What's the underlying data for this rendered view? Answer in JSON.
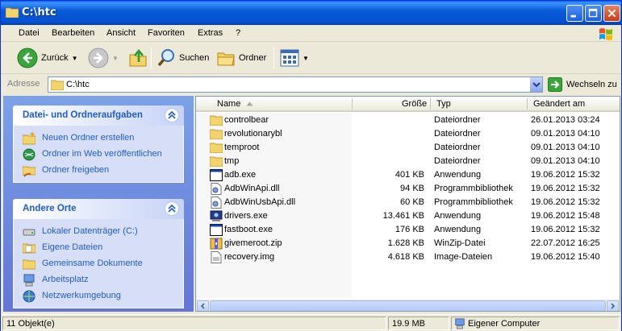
{
  "window": {
    "title": "C:\\htc"
  },
  "menu": [
    "Datei",
    "Bearbeiten",
    "Ansicht",
    "Favoriten",
    "Extras",
    "?"
  ],
  "toolbar": {
    "back_label": "Zurück",
    "search_label": "Suchen",
    "folders_label": "Ordner"
  },
  "address": {
    "label": "Adresse",
    "value": "C:\\htc",
    "go_label": "Wechseln zu"
  },
  "taskpane": {
    "file_tasks": {
      "title": "Datei- und Ordneraufgaben",
      "items": [
        {
          "label": "Neuen Ordner erstellen",
          "icon": "new-folder-icon"
        },
        {
          "label": "Ordner im Web veröffentlichen",
          "icon": "web-publish-icon"
        },
        {
          "label": "Ordner freigeben",
          "icon": "share-folder-icon"
        }
      ]
    },
    "other_places": {
      "title": "Andere Orte",
      "items": [
        {
          "label": "Lokaler Datenträger (C:)",
          "icon": "drive-icon"
        },
        {
          "label": "Eigene Dateien",
          "icon": "my-documents-icon"
        },
        {
          "label": "Gemeinsame Dokumente",
          "icon": "shared-documents-icon"
        },
        {
          "label": "Arbeitsplatz",
          "icon": "my-computer-icon"
        },
        {
          "label": "Netzwerkumgebung",
          "icon": "network-icon"
        }
      ]
    }
  },
  "list": {
    "columns": {
      "name": "Name",
      "size": "Größe",
      "type": "Typ",
      "modified": "Geändert am"
    },
    "rows": [
      {
        "name": "controlbear",
        "size": "",
        "type": "Dateiordner",
        "modified": "26.01.2013 03:24",
        "icon": "folder-icon"
      },
      {
        "name": "revolutionarybl",
        "size": "",
        "type": "Dateiordner",
        "modified": "09.01.2013 04:10",
        "icon": "folder-icon"
      },
      {
        "name": "temproot",
        "size": "",
        "type": "Dateiordner",
        "modified": "09.01.2013 04:10",
        "icon": "folder-icon"
      },
      {
        "name": "tmp",
        "size": "",
        "type": "Dateiordner",
        "modified": "09.01.2013 04:10",
        "icon": "folder-icon"
      },
      {
        "name": "adb.exe",
        "size": "401 KB",
        "type": "Anwendung",
        "modified": "19.06.2012 15:32",
        "icon": "exe-icon"
      },
      {
        "name": "AdbWinApi.dll",
        "size": "94 KB",
        "type": "Programmbibliothek",
        "modified": "19.06.2012 15:32",
        "icon": "dll-icon"
      },
      {
        "name": "AdbWinUsbApi.dll",
        "size": "60 KB",
        "type": "Programmbibliothek",
        "modified": "19.06.2012 15:32",
        "icon": "dll-icon"
      },
      {
        "name": "drivers.exe",
        "size": "13.461 KB",
        "type": "Anwendung",
        "modified": "19.06.2012 15:48",
        "icon": "installer-icon"
      },
      {
        "name": "fastboot.exe",
        "size": "176 KB",
        "type": "Anwendung",
        "modified": "19.06.2012 15:32",
        "icon": "exe-icon"
      },
      {
        "name": "givemeroot.zip",
        "size": "1.628 KB",
        "type": "WinZip-Datei",
        "modified": "22.07.2012 16:25",
        "icon": "zip-icon"
      },
      {
        "name": "recovery.img",
        "size": "4.618 KB",
        "type": "Image-Dateien",
        "modified": "19.06.2012 15:40",
        "icon": "image-file-icon"
      }
    ]
  },
  "status": {
    "count": "11 Objekt(e)",
    "size": "19.9 MB",
    "location": "Eigener Computer"
  },
  "colors": {
    "titlebar": "#0a5bd8",
    "taskpane_link": "#215dc6",
    "taskpane_bg": "#7ba2e7"
  }
}
